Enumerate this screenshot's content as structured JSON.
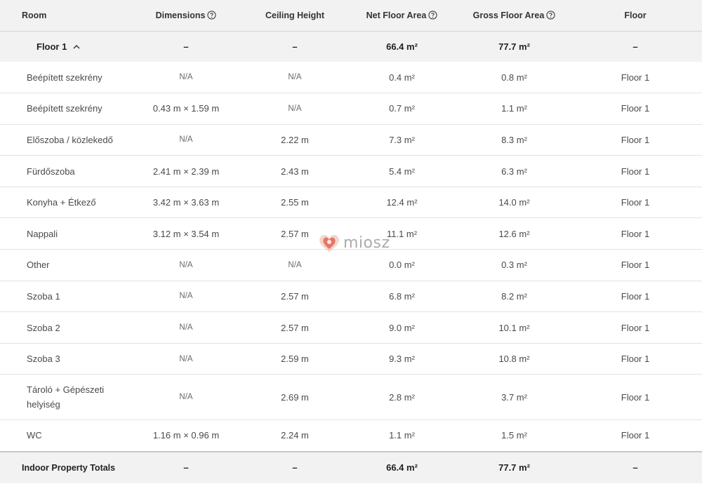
{
  "header": {
    "room": "Room",
    "dimensions": "Dimensions",
    "ceiling_height": "Ceiling Height",
    "net_floor_area": "Net Floor Area",
    "gross_floor_area": "Gross Floor Area",
    "floor": "Floor"
  },
  "group": {
    "name": "Floor 1",
    "expanded": true,
    "dimensions": "–",
    "ceiling_height": "–",
    "net_floor_area": "66.4 m²",
    "gross_floor_area": "77.7 m²",
    "floor": "–"
  },
  "rooms": [
    {
      "room": "Beépített szekrény",
      "dimensions": "N/A",
      "ceiling_height": "N/A",
      "net_floor_area": "0.4 m²",
      "gross_floor_area": "0.8 m²",
      "floor": "Floor 1"
    },
    {
      "room": "Beépített szekrény",
      "dimensions": "0.43 m × 1.59 m",
      "ceiling_height": "N/A",
      "net_floor_area": "0.7 m²",
      "gross_floor_area": "1.1 m²",
      "floor": "Floor 1"
    },
    {
      "room": "Előszoba / közlekedő",
      "dimensions": "N/A",
      "ceiling_height": "2.22 m",
      "net_floor_area": "7.3 m²",
      "gross_floor_area": "8.3 m²",
      "floor": "Floor 1"
    },
    {
      "room": "Fürdőszoba",
      "dimensions": "2.41 m × 2.39 m",
      "ceiling_height": "2.43 m",
      "net_floor_area": "5.4 m²",
      "gross_floor_area": "6.3 m²",
      "floor": "Floor 1"
    },
    {
      "room": "Konyha + Étkező",
      "dimensions": "3.42 m × 3.63 m",
      "ceiling_height": "2.55 m",
      "net_floor_area": "12.4 m²",
      "gross_floor_area": "14.0 m²",
      "floor": "Floor 1"
    },
    {
      "room": "Nappali",
      "dimensions": "3.12 m × 3.54 m",
      "ceiling_height": "2.57 m",
      "net_floor_area": "11.1 m²",
      "gross_floor_area": "12.6 m²",
      "floor": "Floor 1"
    },
    {
      "room": "Other",
      "dimensions": "N/A",
      "ceiling_height": "N/A",
      "net_floor_area": "0.0 m²",
      "gross_floor_area": "0.3 m²",
      "floor": "Floor 1"
    },
    {
      "room": "Szoba 1",
      "dimensions": "N/A",
      "ceiling_height": "2.57 m",
      "net_floor_area": "6.8 m²",
      "gross_floor_area": "8.2 m²",
      "floor": "Floor 1"
    },
    {
      "room": "Szoba 2",
      "dimensions": "N/A",
      "ceiling_height": "2.57 m",
      "net_floor_area": "9.0 m²",
      "gross_floor_area": "10.1 m²",
      "floor": "Floor 1"
    },
    {
      "room": "Szoba 3",
      "dimensions": "N/A",
      "ceiling_height": "2.59 m",
      "net_floor_area": "9.3 m²",
      "gross_floor_area": "10.8 m²",
      "floor": "Floor 1"
    },
    {
      "room": "Tároló + Gépészeti helyiség",
      "dimensions": "N/A",
      "ceiling_height": "2.69 m",
      "net_floor_area": "2.8 m²",
      "gross_floor_area": "3.7 m²",
      "floor": "Floor 1"
    },
    {
      "room": "WC",
      "dimensions": "1.16 m × 0.96 m",
      "ceiling_height": "2.24 m",
      "net_floor_area": "1.1 m²",
      "gross_floor_area": "1.5 m²",
      "floor": "Floor 1"
    }
  ],
  "totals": {
    "label": "Indoor Property Totals",
    "dimensions": "–",
    "ceiling_height": "–",
    "net_floor_area": "66.4 m²",
    "gross_floor_area": "77.7 m²",
    "floor": "–"
  },
  "watermark": {
    "text": "miosz",
    "icon": "heart-logo-icon",
    "color": "#e0523f"
  },
  "colors": {
    "header_bg": "#f2f2f2",
    "divider": "#e3e3e3",
    "text": "#4a4a4a"
  }
}
